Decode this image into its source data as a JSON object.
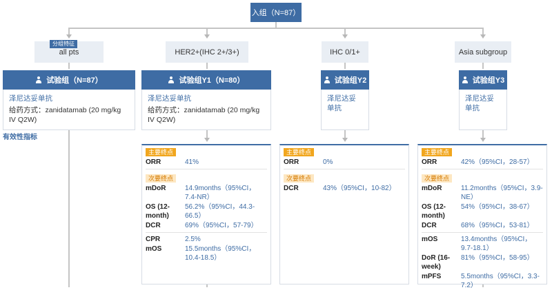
{
  "root": {
    "label": "入组（N=87）"
  },
  "tag": "分组特征",
  "subgroups": [
    "all pts",
    "HER2+(IHC 2+/3+)",
    "IHC 0/1+",
    "Asia subgroup"
  ],
  "arms": [
    {
      "title": "试验组（N=87）",
      "drug": "泽尼达妥单抗",
      "dose": "给药方式：zanidatamab (20 mg/kg IV Q2W)"
    },
    {
      "title": "试验组Y1（N=80）",
      "drug": "泽尼达妥单抗",
      "dose": "给药方式：zanidatamab (20 mg/kg IV Q2W)"
    },
    {
      "title": "试验组Y2",
      "drug": "泽尼达妥单抗",
      "dose": ""
    },
    {
      "title": "试验组Y3",
      "drug": "泽尼达妥单抗",
      "dose": ""
    }
  ],
  "efficacy_label": "有效性指标",
  "labels": {
    "primary": "主要终点",
    "secondary": "次要终点"
  },
  "results": {
    "y1": {
      "primary": [
        {
          "k": "ORR",
          "v": "41%"
        }
      ],
      "secondary": [
        {
          "k": "mDoR",
          "v": "14.9months（95%CI，7.4-NR）"
        },
        {
          "k": "OS (12-month)",
          "v": "56.2%（95%CI，44.3-66.5）"
        },
        {
          "k": "DCR",
          "v": "69%（95%CI，57-79）"
        }
      ],
      "other": [
        {
          "k": "CPR",
          "v": "2.5%"
        },
        {
          "k": "mOS",
          "v": "15.5months（95%CI，10.4-18.5）"
        }
      ]
    },
    "y2": {
      "primary": [
        {
          "k": "ORR",
          "v": "0%"
        }
      ],
      "secondary": [
        {
          "k": "DCR",
          "v": "43%（95%CI，10-82）"
        }
      ]
    },
    "y3": {
      "primary": [
        {
          "k": "ORR",
          "v": "42%（95%CI，28-57）"
        }
      ],
      "secondary": [
        {
          "k": "mDoR",
          "v": "11.2months（95%CI，3.9-NE）"
        },
        {
          "k": "OS (12-month)",
          "v": "54%（95%CI，38-67）"
        },
        {
          "k": "DCR",
          "v": "68%（95%CI，53-81）"
        }
      ],
      "other": [
        {
          "k": "mOS",
          "v": "13.4months（95%CI，9.7-18.1）"
        },
        {
          "k": "DoR (16-week)",
          "v": "81%（95%CI，58-95）"
        },
        {
          "k": "mPFS",
          "v": "5.5months（95%CI，3.3-7.2）"
        }
      ]
    }
  }
}
